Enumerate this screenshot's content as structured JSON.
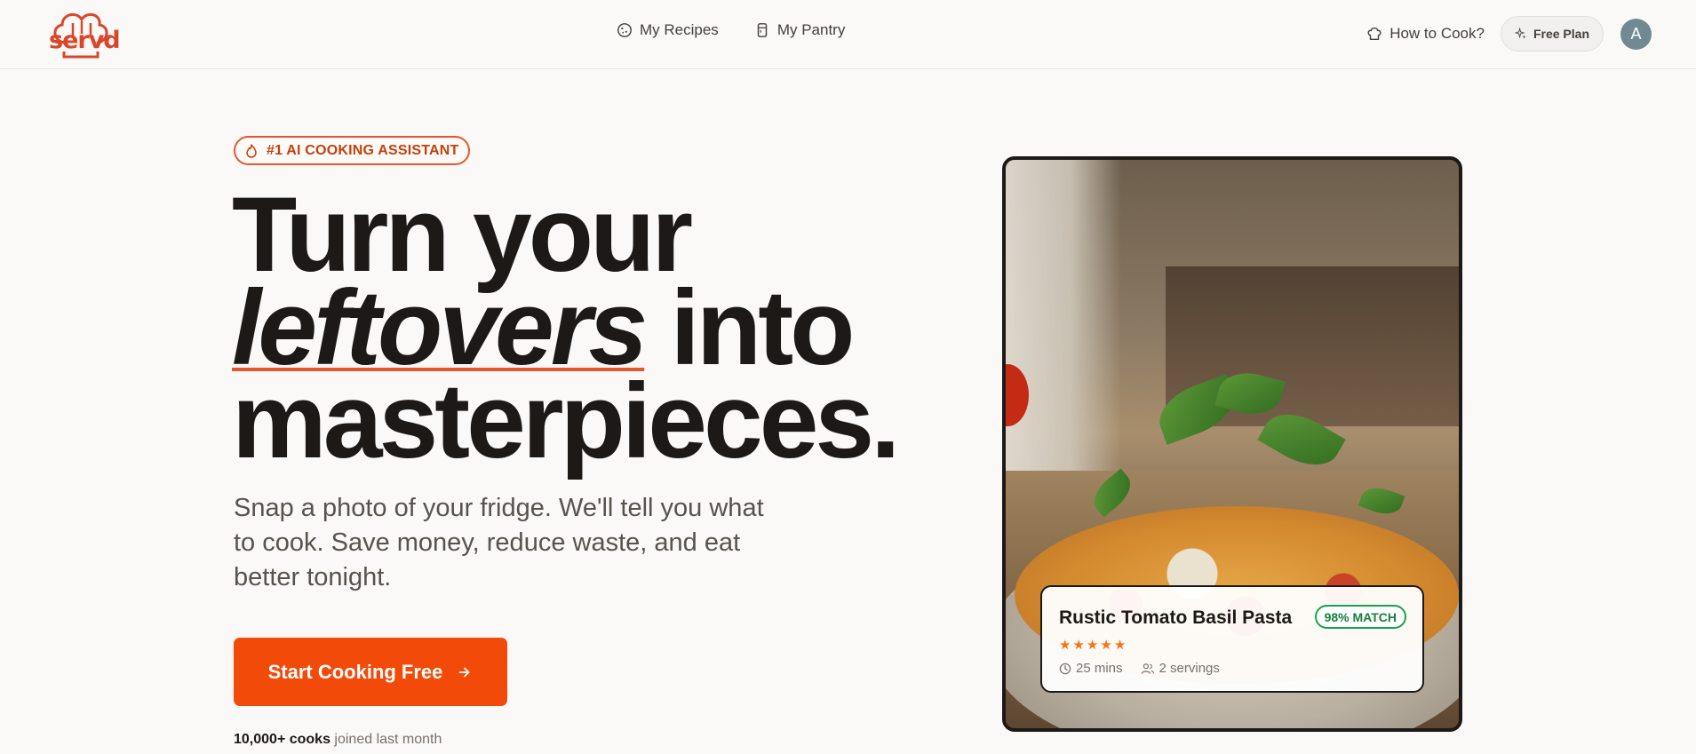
{
  "brand": {
    "logo_text": "servd",
    "accent_color": "#f24a08"
  },
  "nav": {
    "recipes": {
      "label": "My Recipes",
      "icon": "cookie-icon"
    },
    "pantry": {
      "label": "My Pantry",
      "icon": "jar-icon"
    },
    "how_to_cook": {
      "label": "How to Cook?",
      "icon": "chef-hat-icon"
    },
    "plan": {
      "label": "Free Plan",
      "icon": "sparkles-icon"
    },
    "avatar_initial": "A"
  },
  "hero": {
    "badge": "#1 AI COOKING ASSISTANT",
    "headline_line1": "Turn your",
    "headline_emphasis": "leftovers",
    "headline_line2_rest": " into",
    "headline_line3": "masterpieces.",
    "subtext": "Snap a photo of your fridge. We'll tell you what to cook. Save money, reduce waste, and eat better tonight.",
    "cta_label": "Start Cooking Free",
    "social_proof_bold": "10,000+ cooks",
    "social_proof_rest": " joined last month"
  },
  "recipe_card": {
    "title": "Rustic Tomato Basil Pasta",
    "match": "98% MATCH",
    "rating": 5,
    "time": "25 mins",
    "servings": "2 servings"
  }
}
